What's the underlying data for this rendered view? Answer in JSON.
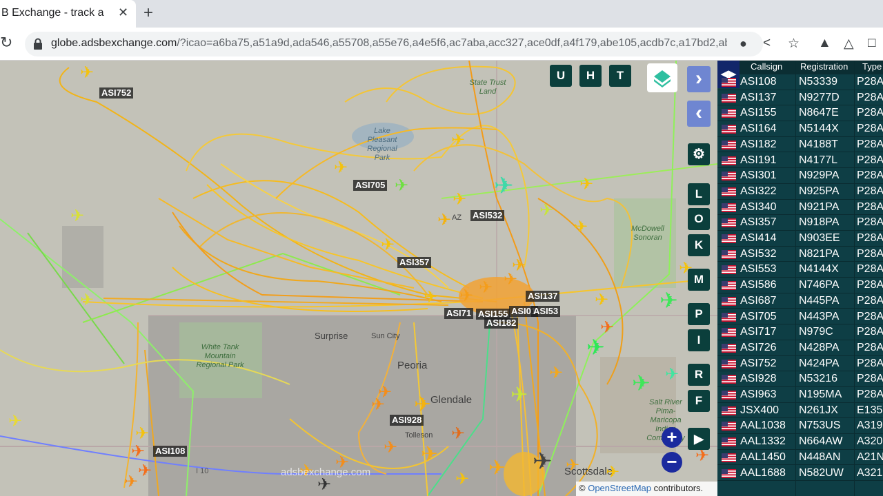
{
  "browser": {
    "tab_title": "B Exchange - track a",
    "tab_close": "✕",
    "new_tab": "+",
    "url_host": "globe.adsbexchange.com",
    "url_path": "/?icao=a6ba75,a51a9d,ada546,a55708,a55e76,a4e5f6,ac7aba,acc327,ace0df,a4f179,abe105,acdb7c,a17bd2,ab..."
  },
  "map": {
    "place_labels": [
      "Surprise",
      "Sun City",
      "Peoria",
      "Glendale",
      "Tolleson",
      "Scottsdale",
      "AZ"
    ],
    "green_labels": [
      "White Tank Mountain Regional Park",
      "State Trust Land",
      "McDowell Sonoran",
      "Salt River Pima-Maricopa Indian Community"
    ],
    "watermark": "adsbexchange.com",
    "attribution_prefix": "©",
    "attribution_link": "OpenStreetMap",
    "attribution_suffix": "contributors.",
    "road_label": "I 10",
    "lake_label": "Lake Pleasant Regional Park",
    "aircraft_labels": [
      "ASI752",
      "ASI705",
      "ASI532",
      "ASI357",
      "ASI137",
      "ASI71",
      "ASI155",
      "ASI182",
      "ASI01",
      "ASI53",
      "ASI928",
      "ASI108"
    ],
    "buttons": {
      "u": "U",
      "h": "H",
      "t": "T",
      "l": "L",
      "o": "O",
      "k": "K",
      "m": "M",
      "p": "P",
      "i": "I",
      "r": "R",
      "f": "F",
      "next": "›",
      "prev": "‹",
      "zoom_in": "+",
      "zoom_out": "−"
    }
  },
  "table": {
    "headers": {
      "callsign": "Callsign",
      "registration": "Registration",
      "type": "Type"
    },
    "rows": [
      {
        "callsign": "ASI108",
        "registration": "N53339",
        "type": "P28A"
      },
      {
        "callsign": "ASI137",
        "registration": "N9277D",
        "type": "P28A"
      },
      {
        "callsign": "ASI155",
        "registration": "N8647E",
        "type": "P28A"
      },
      {
        "callsign": "ASI164",
        "registration": "N5144X",
        "type": "P28A"
      },
      {
        "callsign": "ASI182",
        "registration": "N4188T",
        "type": "P28A"
      },
      {
        "callsign": "ASI191",
        "registration": "N4177L",
        "type": "P28A"
      },
      {
        "callsign": "ASI301",
        "registration": "N929PA",
        "type": "P28A"
      },
      {
        "callsign": "ASI322",
        "registration": "N925PA",
        "type": "P28A"
      },
      {
        "callsign": "ASI340",
        "registration": "N921PA",
        "type": "P28A"
      },
      {
        "callsign": "ASI357",
        "registration": "N918PA",
        "type": "P28A"
      },
      {
        "callsign": "ASI414",
        "registration": "N903EE",
        "type": "P28A"
      },
      {
        "callsign": "ASI532",
        "registration": "N821PA",
        "type": "P28A"
      },
      {
        "callsign": "ASI553",
        "registration": "N4144X",
        "type": "P28A"
      },
      {
        "callsign": "ASI586",
        "registration": "N746PA",
        "type": "P28A"
      },
      {
        "callsign": "ASI687",
        "registration": "N445PA",
        "type": "P28A"
      },
      {
        "callsign": "ASI705",
        "registration": "N443PA",
        "type": "P28A"
      },
      {
        "callsign": "ASI717",
        "registration": "N979C",
        "type": "P28A"
      },
      {
        "callsign": "ASI726",
        "registration": "N428PA",
        "type": "P28A"
      },
      {
        "callsign": "ASI752",
        "registration": "N424PA",
        "type": "P28A"
      },
      {
        "callsign": "ASI928",
        "registration": "N53216",
        "type": "P28A"
      },
      {
        "callsign": "ASI963",
        "registration": "N195MA",
        "type": "P28A"
      },
      {
        "callsign": "JSX400",
        "registration": "N261JX",
        "type": "E135"
      },
      {
        "callsign": "AAL1038",
        "registration": "N753US",
        "type": "A319"
      },
      {
        "callsign": "AAL1332",
        "registration": "N664AW",
        "type": "A320"
      },
      {
        "callsign": "AAL1450",
        "registration": "N448AN",
        "type": "A21N"
      },
      {
        "callsign": "AAL1688",
        "registration": "N582UW",
        "type": "A321"
      }
    ]
  }
}
